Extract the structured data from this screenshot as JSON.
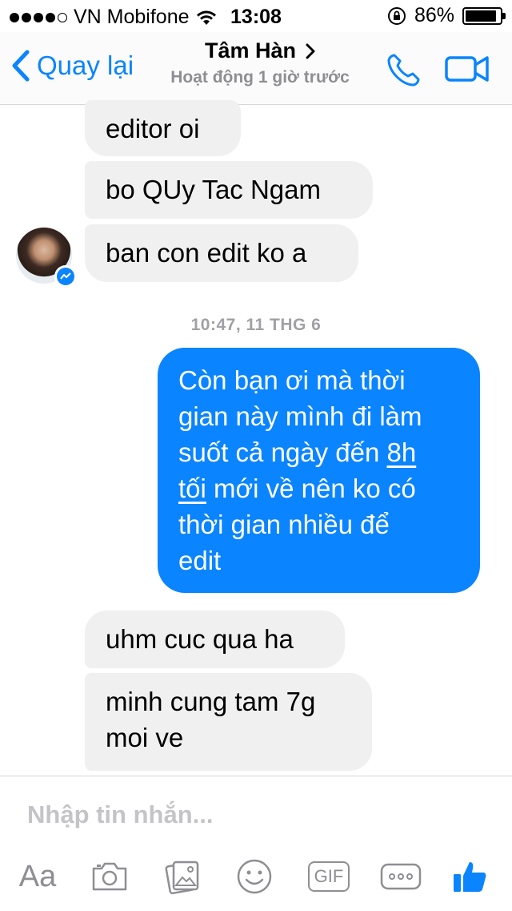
{
  "status_bar": {
    "carrier": "VN Mobifone",
    "time": "13:08",
    "battery": "86%"
  },
  "nav": {
    "back_label": "Quay lại",
    "contact_name": "Tâm Hàn",
    "contact_status": "Hoạt động 1 giờ trước"
  },
  "messages": {
    "m1": "editor oi",
    "m2": "bo QUy Tac Ngam",
    "m3": "ban con edit ko a",
    "timestamp": "10:47, 11 THG 6",
    "mine": {
      "line1": "Còn bạn ơi mà thời",
      "line2": "gian này mình đi làm",
      "line3a": "suốt cả ngày đến ",
      "line3b": "8h",
      "line4a": "tối",
      "line4b": " mới về nên ko có",
      "line5": "thời gian nhiều để",
      "line6": "edit"
    },
    "m5": "uhm cuc qua ha",
    "m6_line1": "minh cung tam 7g",
    "m6_line2": "moi ve"
  },
  "composer": {
    "placeholder": "Nhập tin nhắn...",
    "text_tool": "Aa",
    "gif_tool": "GIF"
  },
  "colors": {
    "accent": "#0a84ff",
    "incoming_bubble": "#f0f0f0"
  }
}
